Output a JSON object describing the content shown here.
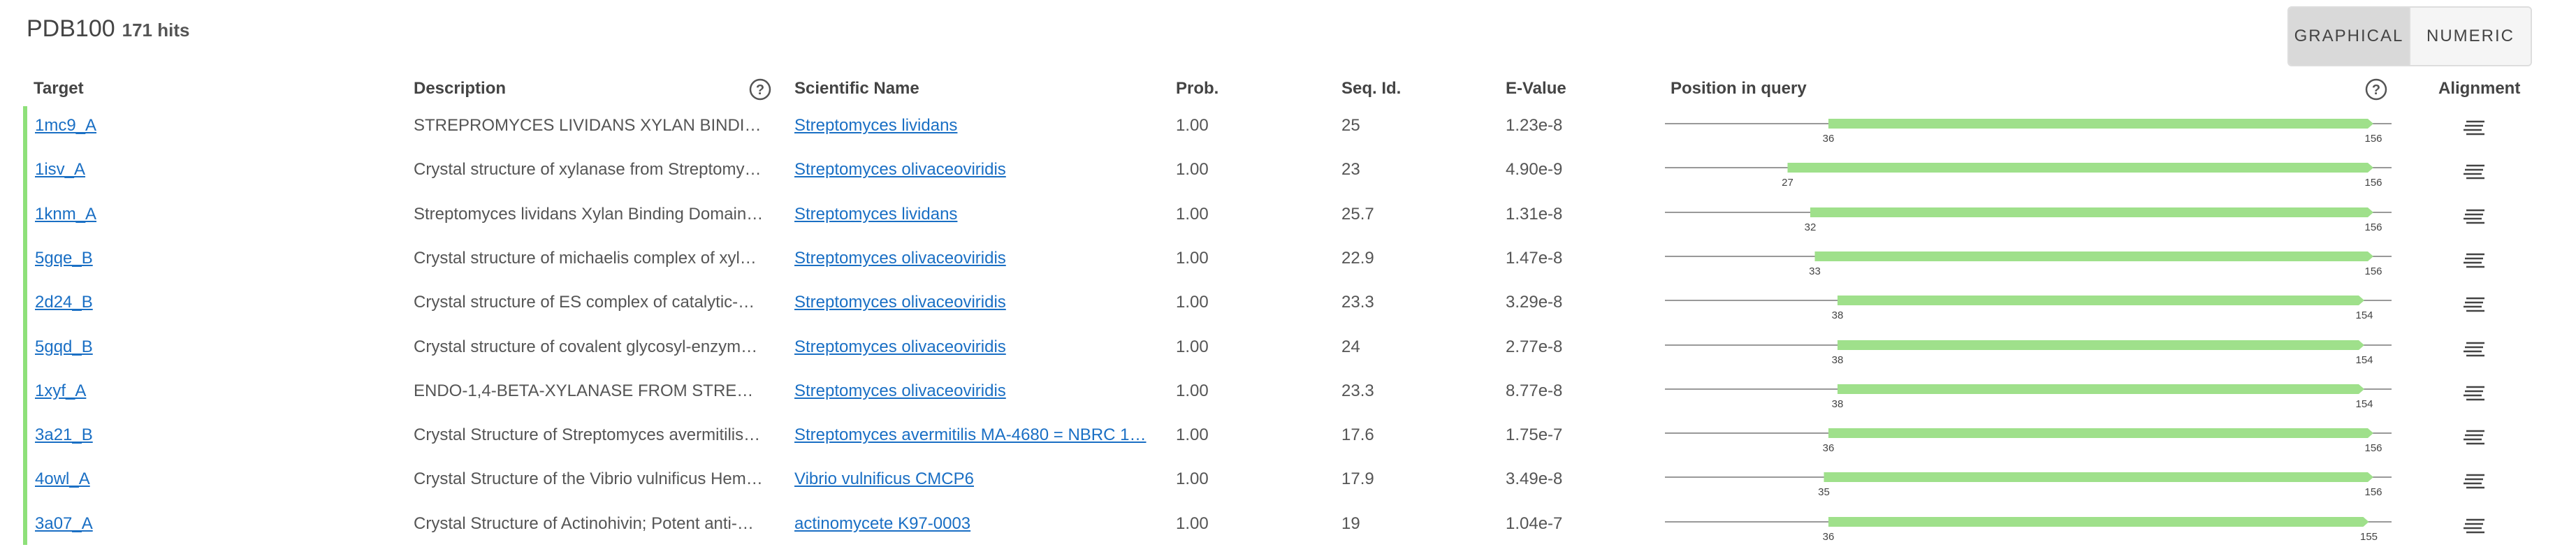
{
  "header": {
    "database": "PDB100",
    "hits": "171 hits",
    "toggle": {
      "graphical": "GRAPHICAL",
      "numeric": "NUMERIC",
      "selected": "graphical"
    }
  },
  "columns": {
    "target": "Target",
    "description": "Description",
    "scientific_name": "Scientific Name",
    "prob": "Prob.",
    "seq_id": "Seq. Id.",
    "evalue": "E-Value",
    "position": "Position in query",
    "alignment": "Alignment"
  },
  "colors": {
    "accent_bar": "#8ee07a",
    "link": "#1a6fc4",
    "query_track": "#9fe08b"
  },
  "icons": {
    "help": "help-circle-icon",
    "alignment": "alignment-lines-icon"
  },
  "query_length": 160,
  "rows": [
    {
      "target": "1mc9_A",
      "description": "STREPROMYCES LIVIDANS XYLAN BINDI…",
      "scientific_name": "Streptomyces lividans",
      "prob": "1.00",
      "seq_id": "25",
      "evalue": "1.23e-8",
      "start": 36,
      "end": 156,
      "start_label": "36",
      "end_label": "156"
    },
    {
      "target": "1isv_A",
      "description": "Crystal structure of xylanase from Streptomy…",
      "scientific_name": "Streptomyces olivaceoviridis",
      "prob": "1.00",
      "seq_id": "23",
      "evalue": "4.90e-9",
      "start": 27,
      "end": 156,
      "start_label": "27",
      "end_label": "156"
    },
    {
      "target": "1knm_A",
      "description": "Streptomyces lividans Xylan Binding Domain…",
      "scientific_name": "Streptomyces lividans",
      "prob": "1.00",
      "seq_id": "25.7",
      "evalue": "1.31e-8",
      "start": 32,
      "end": 156,
      "start_label": "32",
      "end_label": "156"
    },
    {
      "target": "5gqe_B",
      "description": "Crystal structure of michaelis complex of xyl…",
      "scientific_name": "Streptomyces olivaceoviridis",
      "prob": "1.00",
      "seq_id": "22.9",
      "evalue": "1.47e-8",
      "start": 33,
      "end": 156,
      "start_label": "33",
      "end_label": "156"
    },
    {
      "target": "2d24_B",
      "description": "Crystal structure of ES complex of catalytic-…",
      "scientific_name": "Streptomyces olivaceoviridis",
      "prob": "1.00",
      "seq_id": "23.3",
      "evalue": "3.29e-8",
      "start": 38,
      "end": 154,
      "start_label": "38",
      "end_label": "154"
    },
    {
      "target": "5gqd_B",
      "description": "Crystal structure of covalent glycosyl-enzym…",
      "scientific_name": "Streptomyces olivaceoviridis",
      "prob": "1.00",
      "seq_id": "24",
      "evalue": "2.77e-8",
      "start": 38,
      "end": 154,
      "start_label": "38",
      "end_label": "154"
    },
    {
      "target": "1xyf_A",
      "description": "ENDO-1,4-BETA-XYLANASE FROM STRE…",
      "scientific_name": "Streptomyces olivaceoviridis",
      "prob": "1.00",
      "seq_id": "23.3",
      "evalue": "8.77e-8",
      "start": 38,
      "end": 154,
      "start_label": "38",
      "end_label": "154"
    },
    {
      "target": "3a21_B",
      "description": "Crystal Structure of Streptomyces avermitilis…",
      "scientific_name": "Streptomyces avermitilis MA-4680 = NBRC 1…",
      "prob": "1.00",
      "seq_id": "17.6",
      "evalue": "1.75e-7",
      "start": 36,
      "end": 156,
      "start_label": "36",
      "end_label": "156"
    },
    {
      "target": "4owl_A",
      "description": "Crystal Structure of the Vibrio vulnificus Hem…",
      "scientific_name": "Vibrio vulnificus CMCP6",
      "prob": "1.00",
      "seq_id": "17.9",
      "evalue": "3.49e-8",
      "start": 35,
      "end": 156,
      "start_label": "35",
      "end_label": "156"
    },
    {
      "target": "3a07_A",
      "description": "Crystal Structure of Actinohivin; Potent anti-…",
      "scientific_name": "actinomycete K97-0003",
      "prob": "1.00",
      "seq_id": "19",
      "evalue": "1.04e-7",
      "start": 36,
      "end": 155,
      "start_label": "36",
      "end_label": "155"
    }
  ]
}
